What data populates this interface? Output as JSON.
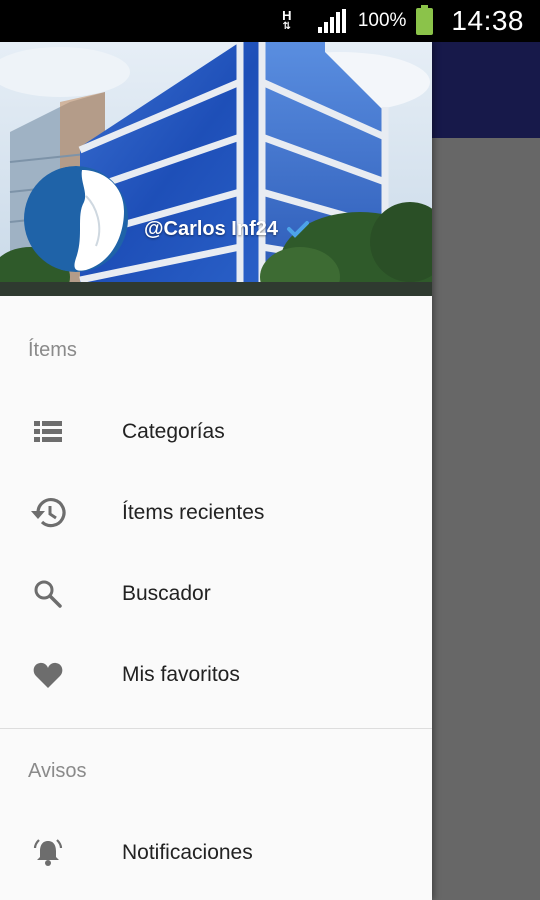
{
  "status_bar": {
    "network": "H",
    "battery": "100%",
    "time": "14:38"
  },
  "drawer": {
    "header": {
      "username": "@Carlos Inf24"
    },
    "sections": [
      {
        "label": "Ítems",
        "items": [
          {
            "label": "Categorías",
            "icon": "list-icon"
          },
          {
            "label": "Ítems recientes",
            "icon": "history-icon"
          },
          {
            "label": "Buscador",
            "icon": "search-icon"
          },
          {
            "label": "Mis favoritos",
            "icon": "heart-icon"
          }
        ]
      },
      {
        "label": "Avisos",
        "items": [
          {
            "label": "Notificaciones",
            "icon": "bell-icon"
          }
        ]
      }
    ]
  },
  "colors": {
    "app_toolbar": "#17194a",
    "scrim": "#676767",
    "verified_badge": "#4da3e8"
  }
}
